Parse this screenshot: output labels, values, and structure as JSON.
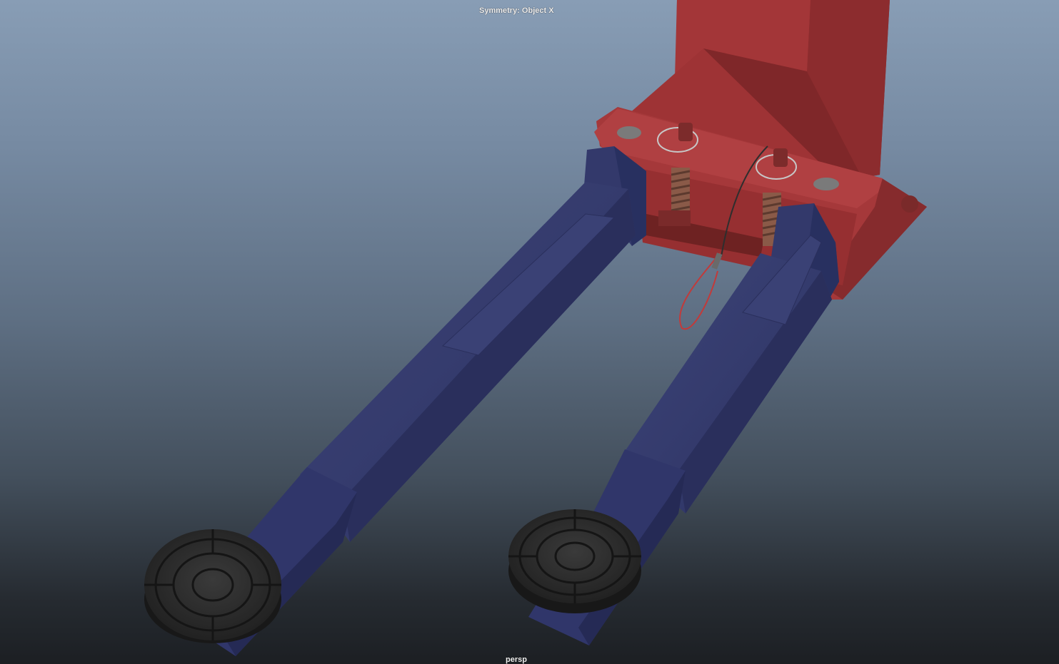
{
  "viewport": {
    "symmetry_label": "Symmetry: Object X",
    "camera_label": "persp"
  },
  "scene": {
    "objects": [
      "lift-column",
      "lift-arm-left",
      "lift-arm-right",
      "rubber-pad-left",
      "rubber-pad-right",
      "lock-spring-left",
      "lock-spring-right",
      "release-cable"
    ],
    "colors": {
      "column": "#a8383a",
      "arm": "#33396b",
      "pad": "#2c2c2c",
      "spring": "#8a5a48",
      "cable": "#c23a3a"
    }
  }
}
